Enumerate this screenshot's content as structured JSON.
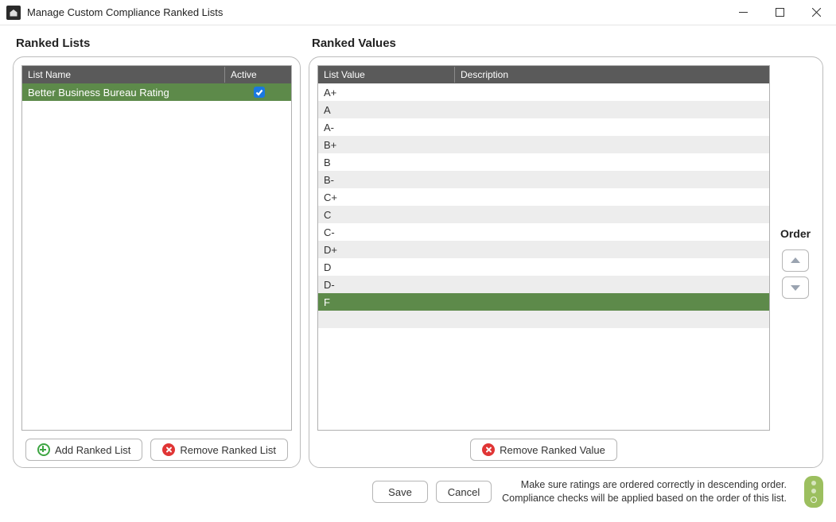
{
  "window": {
    "title": "Manage Custom Compliance Ranked Lists"
  },
  "left_panel": {
    "heading": "Ranked Lists",
    "columns": {
      "name": "List Name",
      "active": "Active"
    },
    "rows": [
      {
        "name": "Better Business Bureau Rating",
        "active": true,
        "selected": true
      }
    ],
    "add_btn": "Add Ranked List",
    "remove_btn": "Remove Ranked List"
  },
  "right_panel": {
    "heading": "Ranked Values",
    "columns": {
      "value": "List Value",
      "desc": "Description"
    },
    "rows": [
      {
        "value": "A+",
        "desc": ""
      },
      {
        "value": "A",
        "desc": ""
      },
      {
        "value": "A-",
        "desc": ""
      },
      {
        "value": "B+",
        "desc": ""
      },
      {
        "value": "B",
        "desc": ""
      },
      {
        "value": "B-",
        "desc": ""
      },
      {
        "value": "C+",
        "desc": ""
      },
      {
        "value": "C",
        "desc": ""
      },
      {
        "value": "C-",
        "desc": ""
      },
      {
        "value": "D+",
        "desc": ""
      },
      {
        "value": "D",
        "desc": ""
      },
      {
        "value": "D-",
        "desc": ""
      },
      {
        "value": "F",
        "desc": "",
        "selected": true
      }
    ],
    "remove_btn": "Remove Ranked Value",
    "order_label": "Order"
  },
  "footer": {
    "save": "Save",
    "cancel": "Cancel",
    "help_line1": "Make sure ratings are ordered correctly in descending order.",
    "help_line2": "Compliance checks will be applied based on the order of this list."
  }
}
